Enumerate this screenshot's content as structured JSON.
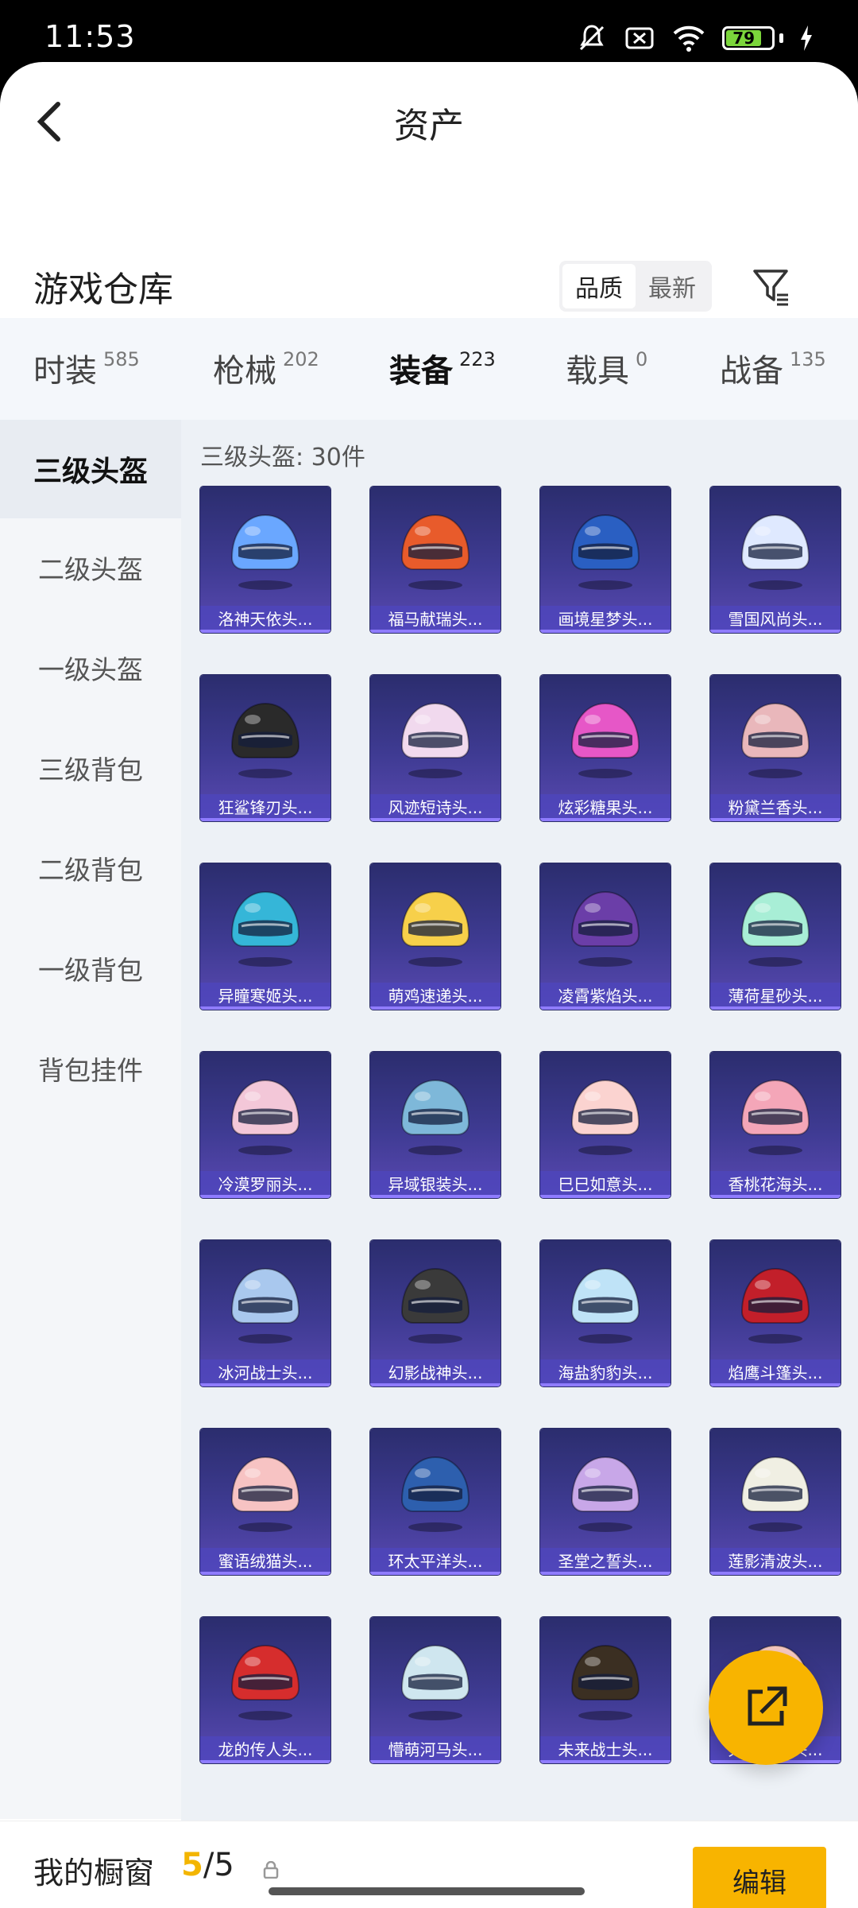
{
  "status": {
    "time": "11:53",
    "battery": "79"
  },
  "header": {
    "title": "资产"
  },
  "warehouse": {
    "title": "游戏仓库",
    "sort": [
      "品质",
      "最新"
    ],
    "sort_selected": "品质"
  },
  "categories": [
    {
      "label": "时装",
      "count": "585"
    },
    {
      "label": "枪械",
      "count": "202"
    },
    {
      "label": "装备",
      "count": "223"
    },
    {
      "label": "载具",
      "count": "0"
    },
    {
      "label": "战备",
      "count": "135"
    }
  ],
  "active_category": "装备",
  "sidebar": [
    "三级头盔",
    "二级头盔",
    "一级头盔",
    "三级背包",
    "二级背包",
    "一级背包",
    "背包挂件"
  ],
  "section_title": "三级头盔: 30件",
  "items": [
    {
      "name": "洛神天依头...",
      "color": "#6aa7ff"
    },
    {
      "name": "福马献瑞头...",
      "color": "#e85b2b"
    },
    {
      "name": "画境星梦头...",
      "color": "#2a5fc2"
    },
    {
      "name": "雪国风尚头...",
      "color": "#dfe9ff"
    },
    {
      "name": "狂鲨锋刃头...",
      "color": "#2a2a2a"
    },
    {
      "name": "风迹短诗头...",
      "color": "#f1d9ee"
    },
    {
      "name": "炫彩糖果头...",
      "color": "#e657c7"
    },
    {
      "name": "粉黛兰香头...",
      "color": "#e9b7bb"
    },
    {
      "name": "异瞳寒姬头...",
      "color": "#35b6d8"
    },
    {
      "name": "萌鸡速递头...",
      "color": "#f7d04a"
    },
    {
      "name": "凌霄紫焰头...",
      "color": "#6b3ea8"
    },
    {
      "name": "薄荷星砂头...",
      "color": "#a8eed6"
    },
    {
      "name": "冷漠罗丽头...",
      "color": "#f3c7d8"
    },
    {
      "name": "异域银装头...",
      "color": "#7eb8d9"
    },
    {
      "name": "巳巳如意头...",
      "color": "#fbd3d0"
    },
    {
      "name": "香桃花海头...",
      "color": "#f4a6b8"
    },
    {
      "name": "冰河战士头...",
      "color": "#a9c8ee"
    },
    {
      "name": "幻影战神头...",
      "color": "#3a3a3a"
    },
    {
      "name": "海盐豹豹头...",
      "color": "#bfe3f7"
    },
    {
      "name": "焰鹰斗篷头...",
      "color": "#c21f2a"
    },
    {
      "name": "蜜语绒猫头...",
      "color": "#f7c3c3"
    },
    {
      "name": "环太平洋头...",
      "color": "#2d5fae"
    },
    {
      "name": "圣堂之誓头...",
      "color": "#c8a7e8"
    },
    {
      "name": "莲影清波头...",
      "color": "#f0efe3"
    },
    {
      "name": "龙的传人头...",
      "color": "#d62d2d"
    },
    {
      "name": "懵萌河马头...",
      "color": "#cfe6ef"
    },
    {
      "name": "未来战士头...",
      "color": "#3b2f22"
    },
    {
      "name": "天降萌吼头...",
      "color": "#f6c8c0"
    }
  ],
  "bottom": {
    "label": "我的橱窗",
    "current": "5",
    "total": "5",
    "edit": "编辑"
  },
  "accent": "#f8b400"
}
